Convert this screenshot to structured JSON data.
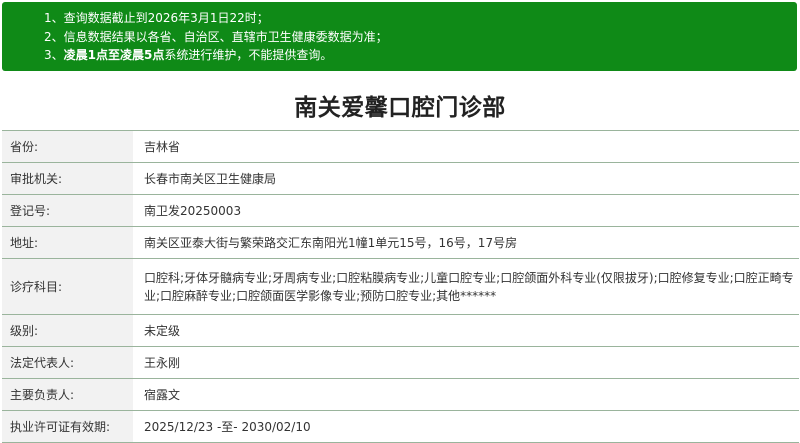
{
  "notice": {
    "line1": {
      "num": "1、",
      "text": "查询数据截止到2026年3月1日22时；"
    },
    "line2": {
      "num": "2、",
      "text": "信息数据结果以各省、自治区、直辖市卫生健康委数据为准；"
    },
    "line3": {
      "num": "3、",
      "bold": "凌晨1点至凌晨5点",
      "text": "系统进行维护，不能提供查询。"
    }
  },
  "title": "南关爱馨口腔门诊部",
  "rows": [
    {
      "label": "省份:",
      "value": "吉林省"
    },
    {
      "label": "审批机关:",
      "value": "长春市南关区卫生健康局"
    },
    {
      "label": "登记号:",
      "value": "南卫发20250003"
    },
    {
      "label": "地址:",
      "value": "南关区亚泰大街与繁荣路交汇东南阳光1幢1单元15号，16号，17号房"
    },
    {
      "label": "诊疗科目:",
      "value": "口腔科;牙体牙髓病专业;牙周病专业;口腔粘膜病专业;儿童口腔专业;口腔颌面外科专业(仅限拔牙);口腔修复专业;口腔正畸专业;口腔麻醉专业;口腔颌面医学影像专业;预防口腔专业;其他******"
    },
    {
      "label": "级别:",
      "value": "未定级"
    },
    {
      "label": "法定代表人:",
      "value": "王永刚"
    },
    {
      "label": "主要负责人:",
      "value": "宿露文"
    },
    {
      "label": "执业许可证有效期:",
      "value": "2025/12/23 -至- 2030/02/10"
    }
  ]
}
